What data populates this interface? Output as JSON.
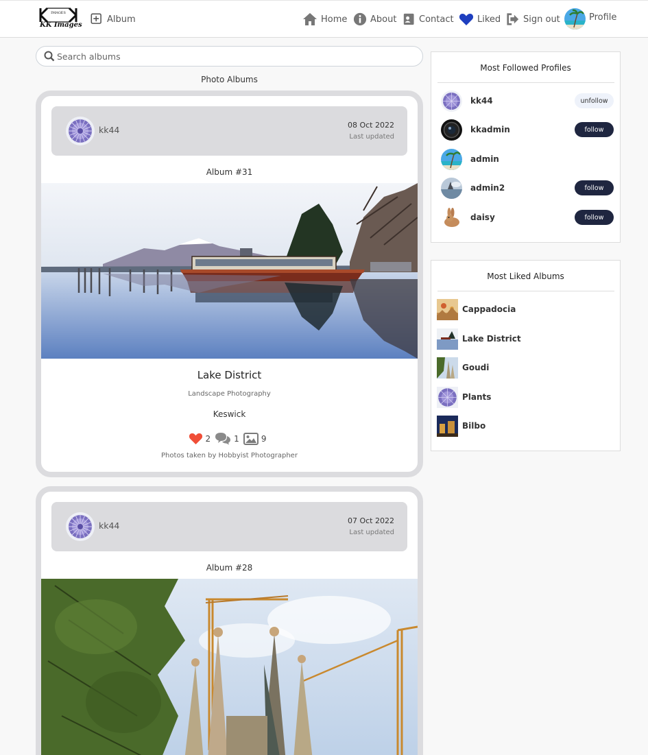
{
  "nav": {
    "logo_text": "KK Images",
    "logo_mark_caption": "IMAGES",
    "album_label": "Album",
    "home_label": "Home",
    "about_label": "About",
    "contact_label": "Contact",
    "liked_label": "Liked",
    "signout_label": "Sign out",
    "profile_label": "Profile",
    "liked_icon_color": "#1e3fbf"
  },
  "search": {
    "placeholder": "Search albums",
    "value": ""
  },
  "main": {
    "section_title": "Photo Albums",
    "albums": [
      {
        "user": "kk44",
        "date": "08 Oct 2022",
        "updated_label": "Last updated",
        "album_number": "Album #31",
        "title": "Lake District",
        "category": "Landscape Photography",
        "location": "Keswick",
        "likes": "2",
        "comments": "1",
        "photos": "9",
        "caption": "Photos taken by Hobbyist Photographer"
      },
      {
        "user": "kk44",
        "date": "07 Oct 2022",
        "updated_label": "Last updated",
        "album_number": "Album #28"
      }
    ]
  },
  "sidebar": {
    "followed_title": "Most Followed Profiles",
    "profiles": [
      {
        "name": "kk44",
        "action": "unfollow"
      },
      {
        "name": "kkadmin",
        "action": "follow"
      },
      {
        "name": "admin",
        "action": ""
      },
      {
        "name": "admin2",
        "action": "follow"
      },
      {
        "name": "daisy",
        "action": "follow"
      }
    ],
    "liked_title": "Most Liked Albums",
    "liked_albums": [
      {
        "name": "Cappadocia"
      },
      {
        "name": "Lake District"
      },
      {
        "name": "Goudi"
      },
      {
        "name": "Plants"
      },
      {
        "name": "Bilbo"
      }
    ]
  },
  "colors": {
    "heart": "#f04e37",
    "follow_button": "#1f2640",
    "unfollow_button": "#eef2fa",
    "card_border": "#dcdcdf",
    "card_header": "#dbdbde"
  }
}
